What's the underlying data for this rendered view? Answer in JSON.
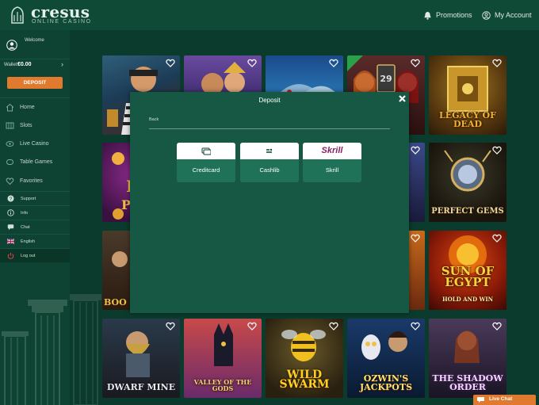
{
  "header": {
    "logo_text": "cresus",
    "logo_sub": "ONLINE CASINO",
    "promotions_label": "Promotions",
    "account_label": "My Account",
    "promotions_icon": "bell-icon",
    "account_icon": "user-circle-icon"
  },
  "sidebar": {
    "welcome": "Welcome",
    "wallet_label": "Wallet:",
    "wallet_value": "€0.00",
    "deposit_label": "DEPOSIT",
    "nav": [
      {
        "label": "Home",
        "icon": "home-icon"
      },
      {
        "label": "Slots",
        "icon": "slots-icon"
      },
      {
        "label": "Live Casino",
        "icon": "live-casino-icon"
      },
      {
        "label": "Table Games",
        "icon": "table-games-icon"
      },
      {
        "label": "Favorites",
        "icon": "heart-icon"
      }
    ],
    "small_links": [
      {
        "label": "Support",
        "icon": "help-icon"
      },
      {
        "label": "Info",
        "icon": "info-icon"
      },
      {
        "label": "Chat",
        "icon": "chat-icon"
      },
      {
        "label": "English",
        "icon": "uk-flag-icon"
      },
      {
        "label": "Log out",
        "icon": "power-icon"
      }
    ]
  },
  "games": [
    {
      "title": ""
    },
    {
      "title": ""
    },
    {
      "title": ""
    },
    {
      "title": ""
    },
    {
      "title": "LEGACY OF DEAD"
    },
    {
      "title": "PERFECT GEMS"
    },
    {
      "title": "SUN OF EGYPT"
    },
    {
      "title": "HOLD AND WIN"
    },
    {
      "title": "DWARF MINE"
    },
    {
      "title": "VALLEY OF THE GODS"
    },
    {
      "title": "WILD SWARM"
    },
    {
      "title": "OZWIN'S JACKPOTS"
    },
    {
      "title": "THE SHADOW ORDER"
    }
  ],
  "modal": {
    "title": "Deposit",
    "back_label": "Back",
    "methods": [
      {
        "label": "Creditcard",
        "logo": "credit-card-logo"
      },
      {
        "label": "Cashlib",
        "logo": "cashlib-logo"
      },
      {
        "label": "Skrill",
        "logo": "Skrill"
      }
    ]
  },
  "livechat": {
    "label": "Live Chat"
  },
  "colors": {
    "background": "#0b3a2c",
    "sidebar": "#0e4233",
    "modal": "#165844",
    "accent": "#e07a2e",
    "skrill": "#862165"
  }
}
